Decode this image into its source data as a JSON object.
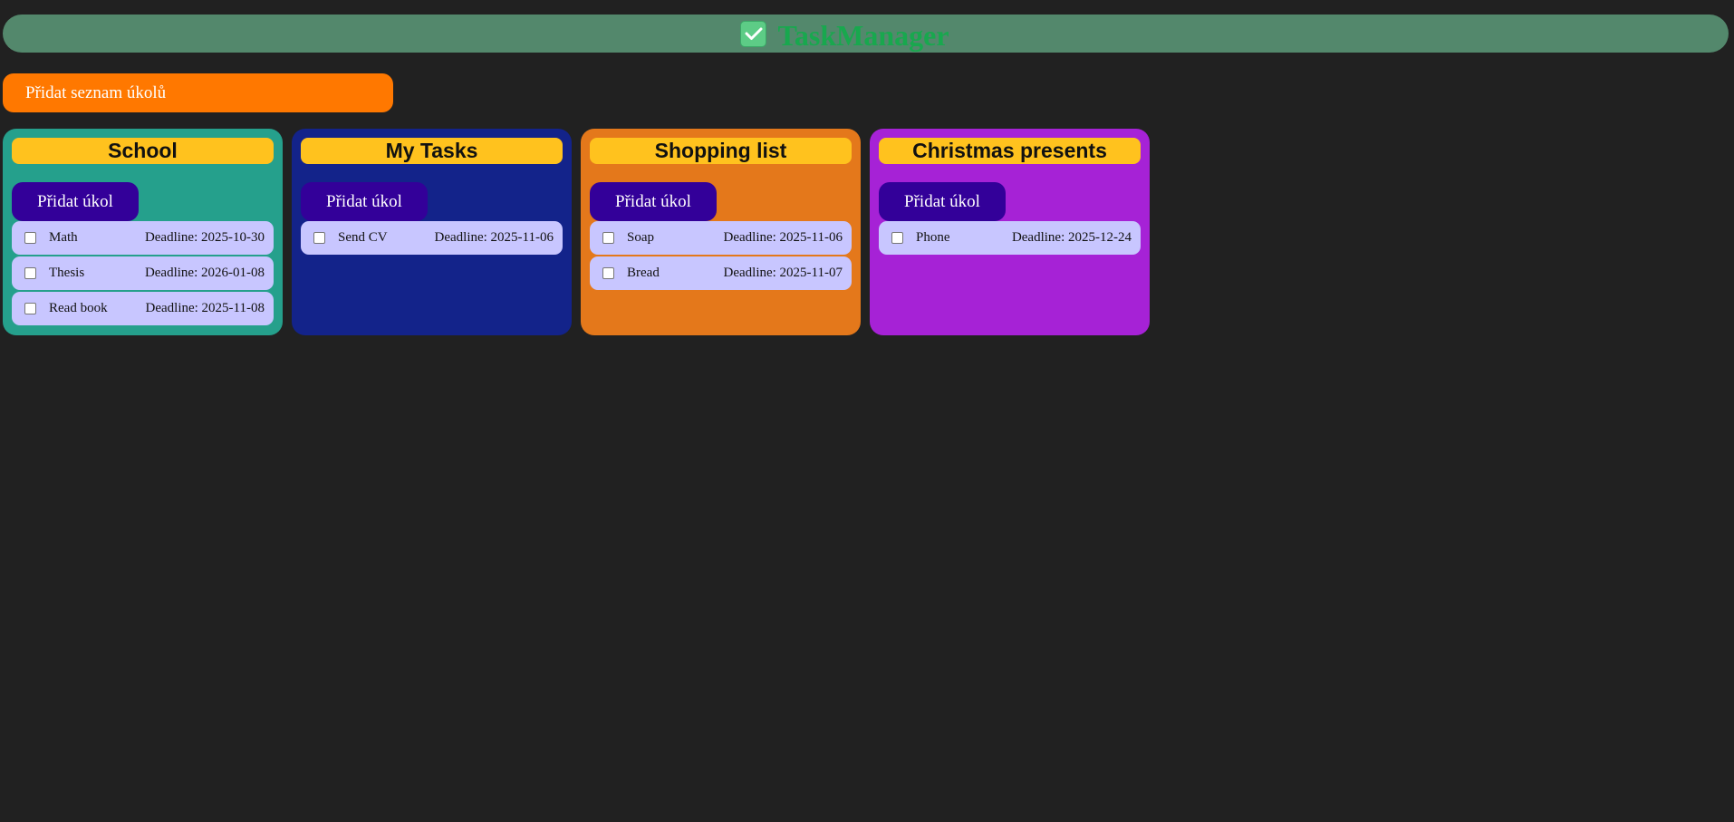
{
  "header": {
    "title": "TaskManager",
    "icon": "check-box-icon",
    "background": "#53886c",
    "title_color": "#18a84e"
  },
  "add_list_button": {
    "label": "Přidat seznam úkolů",
    "color": "#ff7800"
  },
  "lists": [
    {
      "title": "School",
      "color": "#25a08c",
      "add_task_label": "Přidat úkol",
      "tasks": [
        {
          "name": "Math",
          "deadline": "Deadline: 2025-10-30",
          "done": false
        },
        {
          "name": "Thesis",
          "deadline": "Deadline: 2026-01-08",
          "done": false
        },
        {
          "name": "Read book",
          "deadline": "Deadline: 2025-11-08",
          "done": false
        }
      ]
    },
    {
      "title": "My Tasks",
      "color": "#13238a",
      "add_task_label": "Přidat úkol",
      "tasks": [
        {
          "name": "Send CV",
          "deadline": "Deadline: 2025-11-06",
          "done": false
        }
      ]
    },
    {
      "title": "Shopping list",
      "color": "#e4781b",
      "add_task_label": "Přidat úkol",
      "tasks": [
        {
          "name": "Soap",
          "deadline": "Deadline: 2025-11-06",
          "done": false
        },
        {
          "name": "Bread",
          "deadline": "Deadline: 2025-11-07",
          "done": false
        }
      ]
    },
    {
      "title": "Christmas presents",
      "color": "#a622d6",
      "add_task_label": "Přidat úkol",
      "tasks": [
        {
          "name": "Phone",
          "deadline": "Deadline: 2025-12-24",
          "done": false
        }
      ]
    }
  ],
  "colors": {
    "page_background": "#212121",
    "list_title_background": "#ffc21e",
    "add_task_button": "#330099",
    "task_item_background": "#c8c6ff"
  }
}
